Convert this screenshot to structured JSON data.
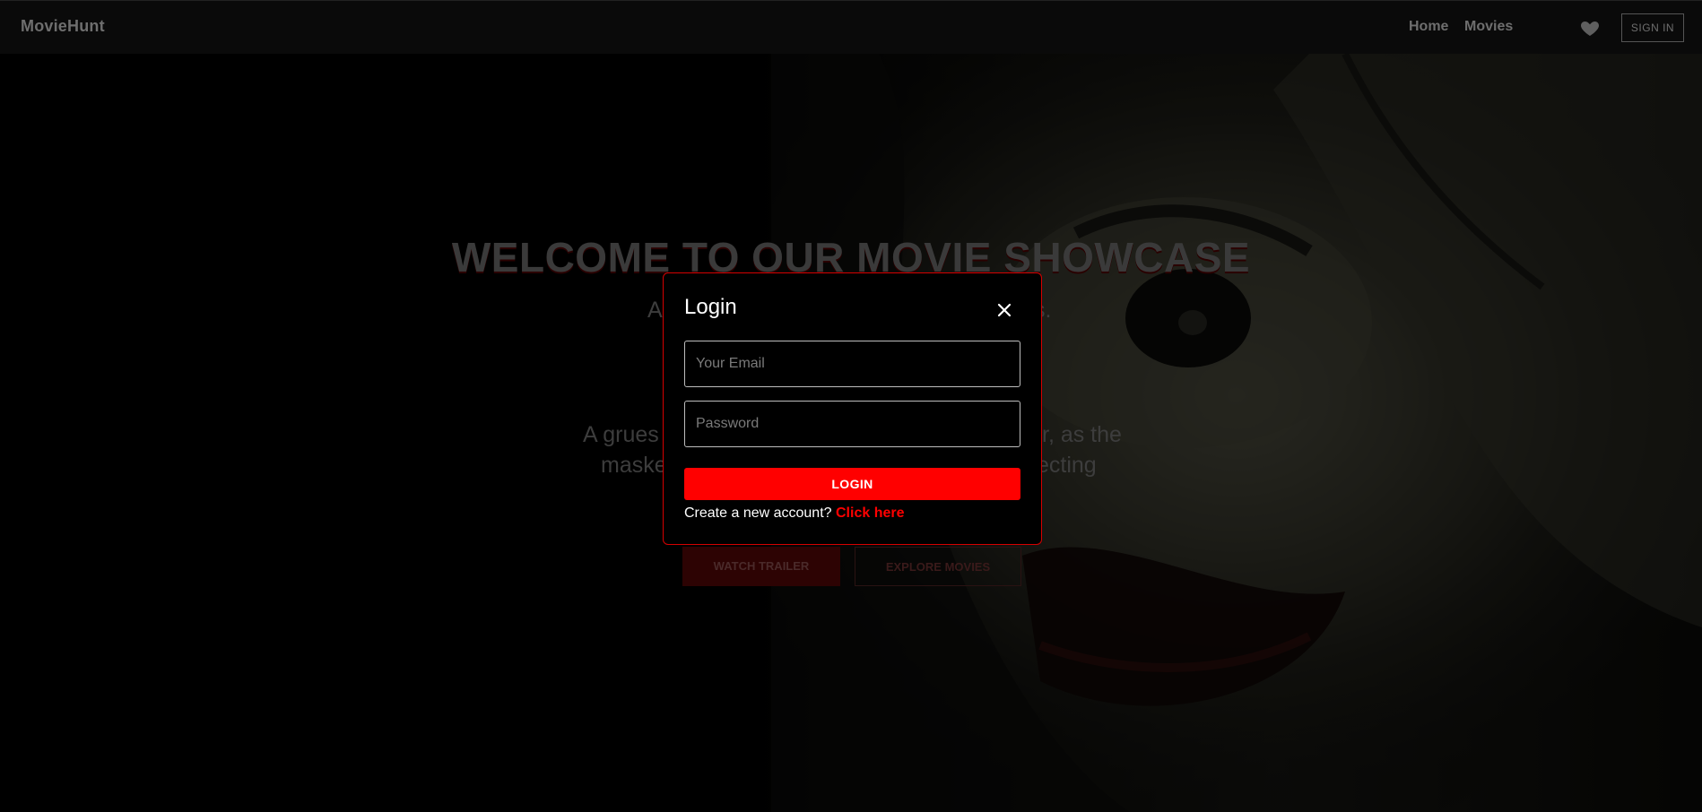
{
  "navbar": {
    "brand": "MovieHunt",
    "links": [
      "Home",
      "Movies"
    ],
    "signin_label": "SIGN IN"
  },
  "hero": {
    "title": "WELCOME TO OUR MOVIE SHOWCASE",
    "subtitle_left": "A",
    "subtitle_right": "s.",
    "desc_line1_left": "A grues",
    "desc_line1_right": "r, as the",
    "desc_line2_left": "maske",
    "desc_line2_right": "ecting",
    "watch_trailer": "WATCH TRAILER",
    "explore_movies": "EXPLORE MOVIES"
  },
  "modal": {
    "title": "Login",
    "email_placeholder": "Your Email",
    "password_placeholder": "Password",
    "login_label": "LOGIN",
    "signup_prompt": "Create a new account?",
    "signup_link": "Click here"
  },
  "colors": {
    "accent": "#ff0000",
    "modal_border": "#d60000",
    "background": "#000000"
  }
}
